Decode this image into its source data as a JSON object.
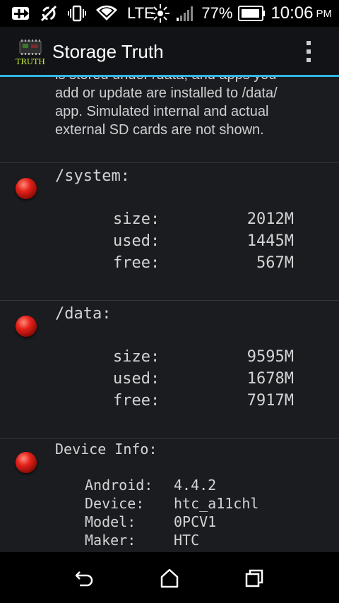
{
  "status_bar": {
    "network": "LTE",
    "battery": "77%",
    "time": "10:06",
    "ampm": "PM"
  },
  "app": {
    "title": "Storage Truth",
    "logo_text": "TRUTH"
  },
  "intro_lines": [
    "is stored under /data, and apps you",
    "add or update are installed to /data/",
    "app. Simulated internal and actual",
    "external SD cards are not shown."
  ],
  "partitions": [
    {
      "title": "/system:",
      "rows": [
        {
          "label": "size:",
          "value": "2012M"
        },
        {
          "label": "used:",
          "value": "1445M"
        },
        {
          "label": "free:",
          "value": "567M"
        }
      ]
    },
    {
      "title": "/data:",
      "rows": [
        {
          "label": "size:",
          "value": "9595M"
        },
        {
          "label": "used:",
          "value": "1678M"
        },
        {
          "label": "free:",
          "value": "7917M"
        }
      ]
    }
  ],
  "device_info": {
    "title": "Device Info:",
    "rows": [
      {
        "label": "Android:",
        "value": "4.4.2"
      },
      {
        "label": "Device:",
        "value": "htc_a11chl"
      },
      {
        "label": "Model:",
        "value": "0PCV1"
      },
      {
        "label": "Maker:",
        "value": "HTC"
      }
    ]
  },
  "icons": {
    "status_left": [
      "add-box-icon",
      "sync-disabled-icon",
      "vibrate-icon",
      "wifi-icon"
    ],
    "status_right": [
      "signal-burst-icon",
      "cell-signal-icon",
      "battery-icon"
    ],
    "nav": [
      "back-icon",
      "home-icon",
      "recents-icon"
    ]
  },
  "colors": {
    "accent": "#33b5e5",
    "status_led": "#e4221a",
    "background": "#1b1c20"
  }
}
